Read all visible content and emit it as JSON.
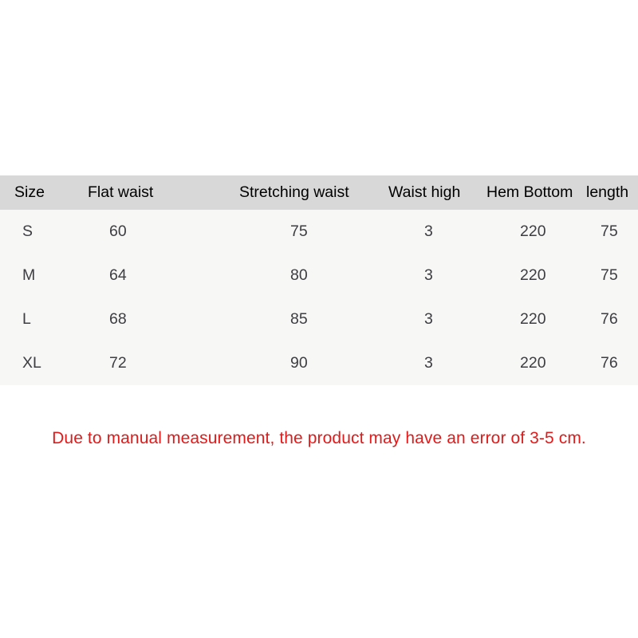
{
  "chart_data": {
    "type": "table",
    "title": "",
    "columns": [
      "Size",
      "Flat waist",
      "Stretching waist",
      "Waist high",
      "Hem Bottom",
      "length"
    ],
    "rows": [
      [
        "S",
        "60",
        "75",
        "3",
        "220",
        "75"
      ],
      [
        "M",
        "64",
        "80",
        "3",
        "220",
        "75"
      ],
      [
        "L",
        "68",
        "85",
        "3",
        "220",
        "76"
      ],
      [
        "XL",
        "72",
        "90",
        "3",
        "220",
        "76"
      ]
    ]
  },
  "table": {
    "headers": {
      "size": "Size",
      "flat_waist": "Flat waist",
      "stretching_waist": "Stretching waist",
      "waist_high": "Waist high",
      "hem_bottom": "Hem Bottom",
      "length": "length"
    },
    "rows": [
      {
        "size": "S",
        "flat_waist": "60",
        "stretching_waist": "75",
        "waist_high": "3",
        "hem_bottom": "220",
        "length": "75"
      },
      {
        "size": "M",
        "flat_waist": "64",
        "stretching_waist": "80",
        "waist_high": "3",
        "hem_bottom": "220",
        "length": "75"
      },
      {
        "size": "L",
        "flat_waist": "68",
        "stretching_waist": "85",
        "waist_high": "3",
        "hem_bottom": "220",
        "length": "76"
      },
      {
        "size": "XL",
        "flat_waist": "72",
        "stretching_waist": "90",
        "waist_high": "3",
        "hem_bottom": "220",
        "length": "76"
      }
    ]
  },
  "notice": {
    "text": "Due to manual measurement, the product may have an error of 3-5 cm."
  },
  "colors": {
    "page_background": "#ffffff",
    "header_row_background": "#d8d8d8",
    "body_row_background": "#f7f7f6",
    "header_text": "#000000",
    "body_text": "#3d3d42",
    "notice_text": "#e01b1b"
  }
}
